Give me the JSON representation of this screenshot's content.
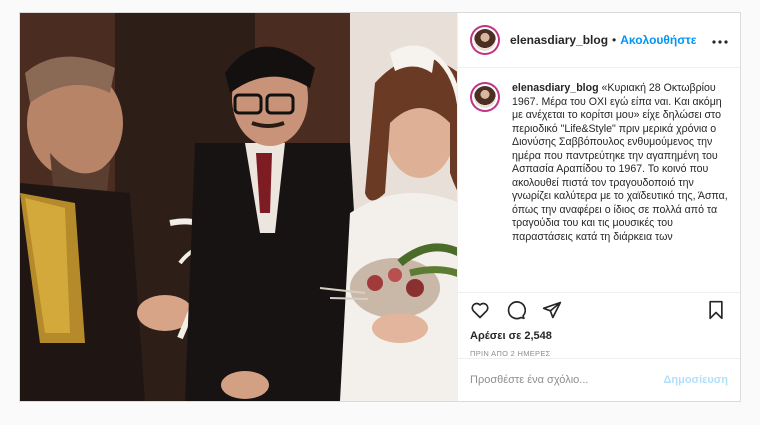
{
  "header": {
    "username": "elenasdiary_blog",
    "separator": "•",
    "follow_label": "Ακολουθήστε",
    "more_icon": "more-horizontal-icon"
  },
  "caption": {
    "username": "elenasdiary_blog",
    "text": "«Κυριακή 28 Οκτωβρίου 1967. Μέρα του ΟΧΙ εγώ είπα ναι. Και ακόμη με ανέχεται το κορίτσι μου» είχε δηλώσει στο περιοδικό \"Life&Style\" πριν μερικά χρόνια ο Διονύσης Σαββόπουλος ενθυμούμενος την ημέρα που παντρεύτηκε την αγαπημένη του Ασπασία Αραπίδου το 1967. Το κοινό που ακολουθεί πιστά τον τραγουδοποιό την γνωρίζει καλύτερα με το χαϊδευτικό της, Άσπα, όπως την αναφέρει ο ίδιος σε πολλά από τα τραγούδια του και τις μουσικές του παραστάσεις κατά τη διάρκεια των"
  },
  "actions": {
    "like_icon": "heart-icon",
    "comment_icon": "comment-icon",
    "share_icon": "share-icon",
    "save_icon": "bookmark-icon"
  },
  "likes": {
    "text": "Αρέσει σε 2,548"
  },
  "timestamp": "ΠΡΙΝ ΑΠΟ 2 ΗΜΕΡΕΣ",
  "comment_box": {
    "placeholder": "Προσθέστε ένα σχόλιο...",
    "post_label": "Δημοσίευση"
  },
  "colors": {
    "accent": "#0095f6",
    "post_disabled": "#b2dffc",
    "border": "#dbdbdb",
    "avatar_ring": "#c13584"
  }
}
